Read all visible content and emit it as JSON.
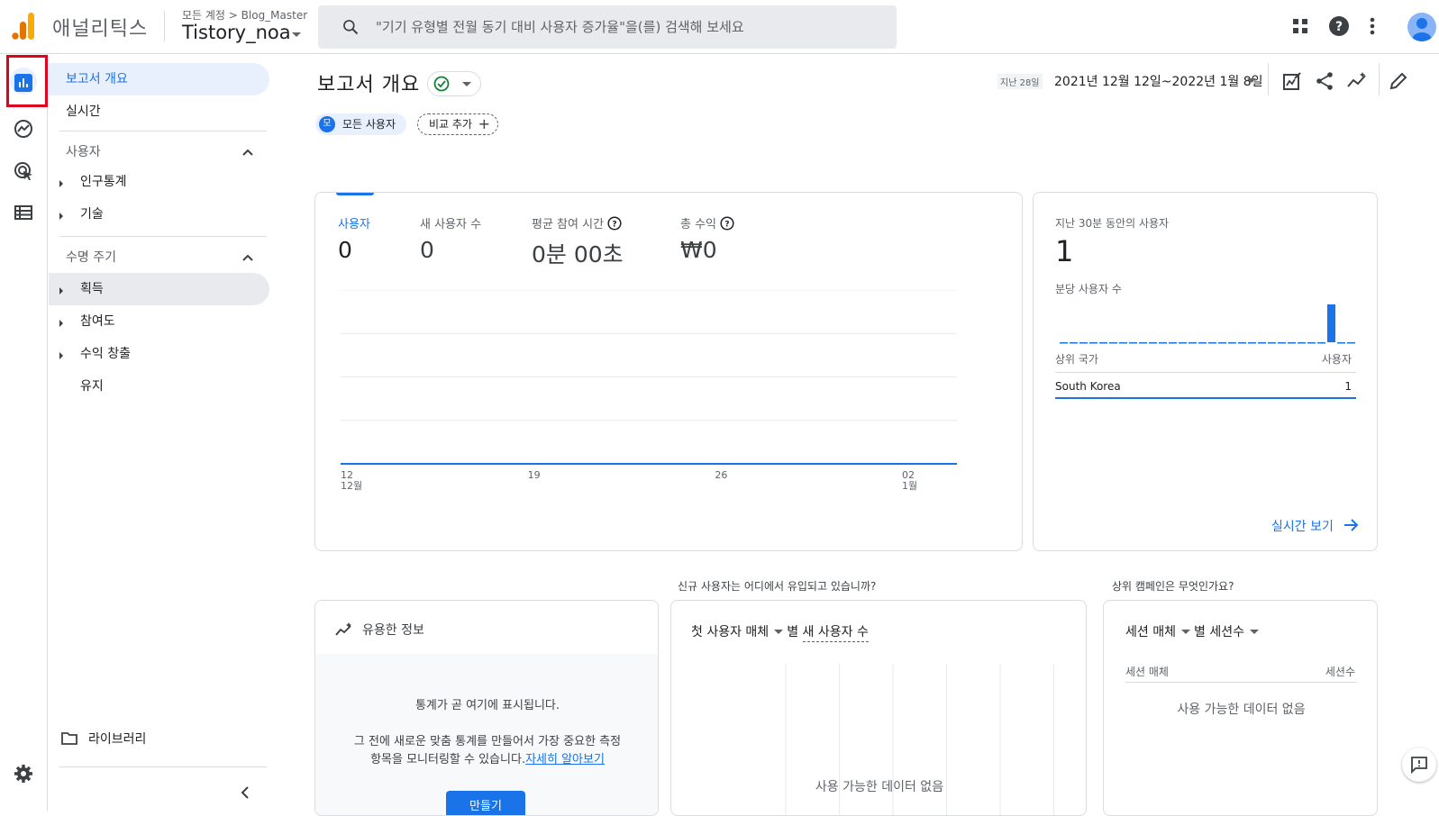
{
  "header": {
    "app_name": "애널리틱스",
    "breadcrumb": "모든 계정 > Blog_Master",
    "property_name": "Tistory_noa",
    "search_placeholder": "\"기기 유형별 전월 동기 대비 사용자 증가율\"을(를) 검색해 보세요",
    "icons": [
      "apps-grid-icon",
      "help-icon",
      "more-vert-icon",
      "account-avatar"
    ]
  },
  "rail": {
    "items": [
      "reports-icon",
      "explore-icon",
      "advertising-icon",
      "configure-icon",
      "settings-icon"
    ]
  },
  "sidenav": {
    "overview": "보고서 개요",
    "realtime": "실시간",
    "users_section": "사용자",
    "demographics": "인구통계",
    "tech": "기술",
    "lifecycle_section": "수명 주기",
    "acquisition": "획득",
    "engagement": "참여도",
    "monetization": "수익 창출",
    "retention": "유지",
    "library": "라이브러리"
  },
  "page": {
    "title": "보고서 개요",
    "date_prefix": "지난 28일",
    "date_range": "2021년 12월 12일~2022년 1월 8일",
    "chip_all_users": "모든 사용자",
    "chip_avatar": "모",
    "chip_compare": "비교 추가"
  },
  "metrics": [
    {
      "label": "사용자",
      "value": "0"
    },
    {
      "label": "새 사용자 수",
      "value": "0"
    },
    {
      "label": "평균 참여 시간",
      "value": "0분 00초"
    },
    {
      "label": "총 수익",
      "value": "₩0"
    }
  ],
  "chart_data": {
    "type": "line",
    "x": [
      "12/12",
      "19",
      "26",
      "01/02"
    ],
    "x_tick_labels": [
      {
        "top": "12",
        "bottom": "12월"
      },
      {
        "top": "19",
        "bottom": ""
      },
      {
        "top": "26",
        "bottom": ""
      },
      {
        "top": "02",
        "bottom": "1월"
      }
    ],
    "series": [
      {
        "name": "사용자",
        "values": [
          0,
          0,
          0,
          0
        ]
      }
    ],
    "color": "#1a73e8",
    "grid": true
  },
  "realtime": {
    "title": "지난 30분 동안의 사용자",
    "count": "1",
    "subtitle": "분당 사용자 수",
    "per_minute": [
      0,
      0,
      0,
      0,
      0,
      0,
      0,
      0,
      0,
      0,
      0,
      0,
      0,
      0,
      0,
      0,
      0,
      0,
      0,
      0,
      0,
      0,
      0,
      0,
      0,
      0,
      0,
      1,
      0,
      0
    ],
    "col_country": "상위 국가",
    "col_users": "사용자",
    "rows": [
      {
        "country": "South Korea",
        "users": "1"
      }
    ],
    "link": "실시간 보기"
  },
  "sections": {
    "source_question": "신규 사용자는 어디에서 유입되고 있습니까?",
    "campaign_question": "상위 캠페인은 무엇인가요?"
  },
  "insight": {
    "title": "유용한 정보",
    "line1": "통계가 곧 여기에 표시됩니다.",
    "line2a": "그 전에 새로운 맞춤 통계를 만들어서 가장 중요한 측정",
    "line2b": "항목을 모니터링할 수 있습니다.",
    "link": "자세히 알아보기",
    "button": "만들기"
  },
  "source_card": {
    "dim": "첫 사용자 매체",
    "by": "별",
    "metric": "새 사용자 수",
    "empty": "사용 가능한 데이터 없음"
  },
  "campaign_card": {
    "dim": "세션 매체",
    "by": "별",
    "metric": "세션수",
    "col1": "세션 매체",
    "col2": "세션수",
    "empty": "사용 가능한 데이터 없음"
  },
  "colors": {
    "accent": "#1a73e8",
    "highlight": "#e0001b",
    "logo_orange": "#f9ab00",
    "logo_dark": "#e37400"
  }
}
